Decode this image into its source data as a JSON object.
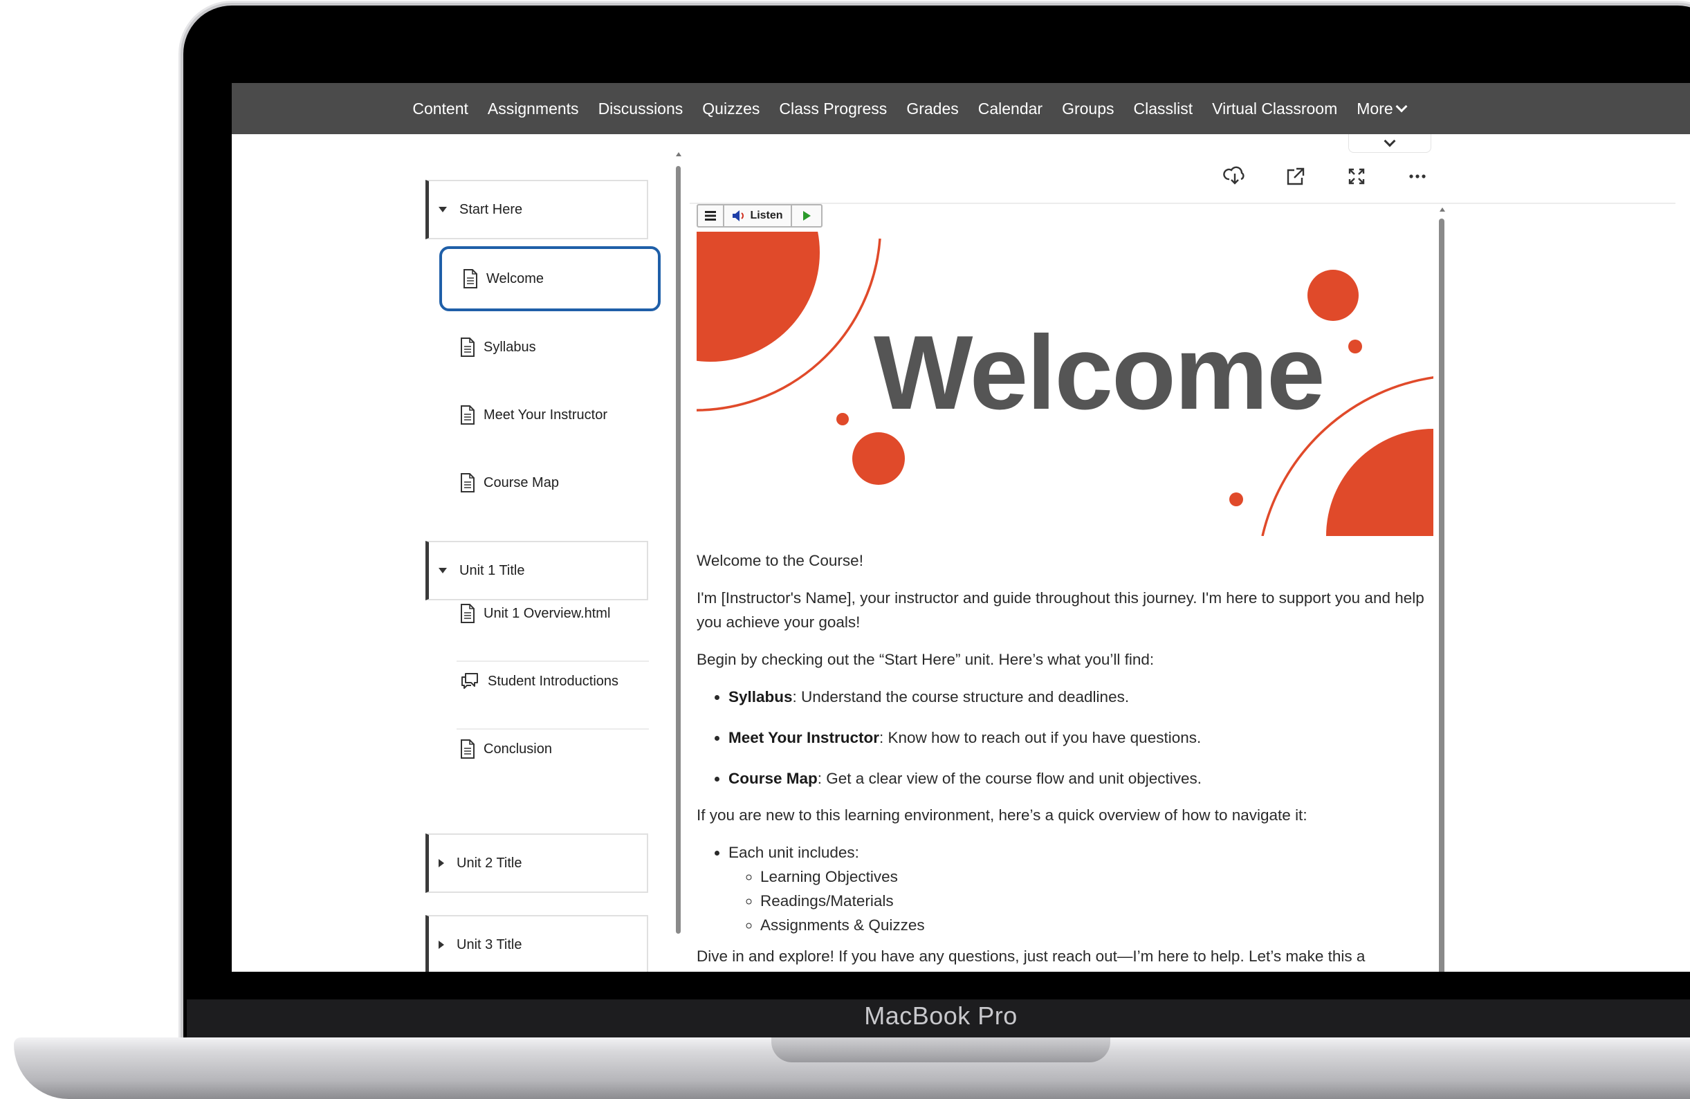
{
  "device": {
    "label": "MacBook Pro"
  },
  "nav": {
    "items": [
      "Content",
      "Assignments",
      "Discussions",
      "Quizzes",
      "Class Progress",
      "Grades",
      "Calendar",
      "Groups",
      "Classlist",
      "Virtual Classroom"
    ],
    "more_label": "More"
  },
  "sidebar": {
    "modules": [
      {
        "label": "Start Here",
        "expanded": true,
        "topics": [
          "Welcome",
          "Syllabus",
          "Meet Your Instructor",
          "Course Map"
        ],
        "selected": "Welcome"
      },
      {
        "label": "Unit 1 Title",
        "expanded": true,
        "topics": [
          "Unit 1 Overview.html",
          "Student Introductions",
          "Conclusion"
        ]
      },
      {
        "label": "Unit 2 Title",
        "expanded": false
      },
      {
        "label": "Unit 3 Title",
        "expanded": false
      }
    ]
  },
  "toolbar": {
    "icons": [
      "download-icon",
      "open-external-icon",
      "fullscreen-icon",
      "more-options-icon"
    ],
    "listen_label": "Listen"
  },
  "banner": {
    "title": "Welcome",
    "accent_color": "#e04a2a",
    "text_color": "#555555"
  },
  "article": {
    "intro": "Welcome to the Course!",
    "p1": "I'm [Instructor's Name], your instructor and guide throughout this journey. I'm here to support you and help you achieve your goals!",
    "p2": "Begin by checking out the “Start Here” unit. Here’s what you’ll find:",
    "bullets": [
      {
        "term": "Syllabus",
        "text": ": Understand the course structure and deadlines."
      },
      {
        "term": "Meet Your Instructor",
        "text": ": Know how to reach out if you have questions."
      },
      {
        "term": "Course Map",
        "text": ": Get a clear view of the course flow and unit objectives."
      }
    ],
    "p3": "If you are new to this learning environment, here’s a quick overview of how to navigate it:",
    "unit_includes": "Each unit includes:",
    "sub_items": [
      "Learning Objectives",
      "Readings/Materials",
      "Assignments & Quizzes"
    ],
    "p4": "Dive in and explore! If you have any questions, just reach out—I’m here to help. Let’s make this a"
  }
}
